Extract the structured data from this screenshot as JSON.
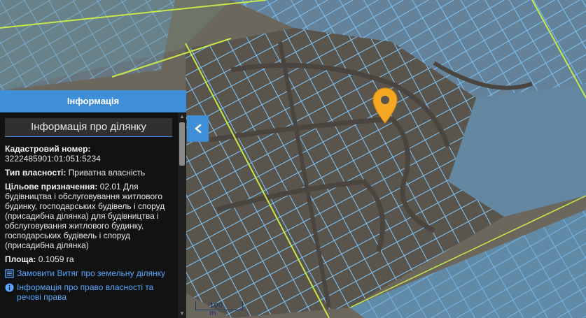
{
  "panel": {
    "header": "Інформація",
    "section_title": "Інформація про ділянку",
    "cadastral_label": "Кадастровий номер:",
    "cadastral_value": "3222485901:01:051:5234",
    "ownership_label": "Тип власності:",
    "ownership_value": "Приватна власність",
    "purpose_label": "Цільове призначення:",
    "purpose_value": "02.01 Для будівництва і обслуговування житлового будинку, господарських будівель і споруд (присадибна ділянка) для будівництва і обслуговування житлового будинку, господарських будівель і споруд (присадибна ділянка)",
    "area_label": "Площа:",
    "area_value": "0.1059 га",
    "order_link": "Замовити Витяг про земельну ділянку",
    "rights_link": "Інформація про право власності та речові права"
  },
  "map": {
    "scale_label": "100 m",
    "marker_color": "#f5a623",
    "parcel_color": "#7ec8ff",
    "boundary_color": "#c7e84a",
    "overlay_color": "#5aa7e6"
  },
  "icons": {
    "collapse": "chevron-left-icon",
    "order": "document-list-icon",
    "rights": "info-circle-icon",
    "marker": "map-pin-icon"
  }
}
